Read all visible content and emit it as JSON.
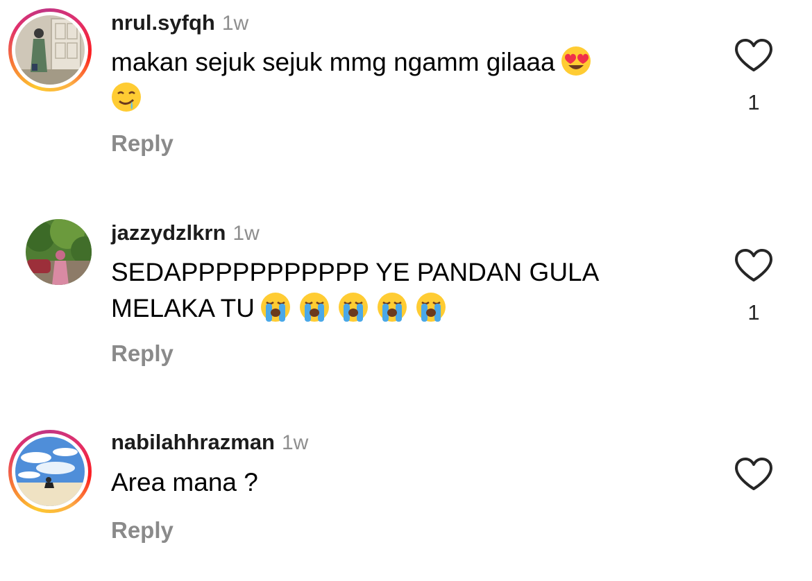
{
  "comments": [
    {
      "username": "nrul.syfqh",
      "time": "1w",
      "text": "makan sejuk sejuk mmg ngamm gilaaa",
      "emojis": [
        "heart-eyes-emoji",
        "drooling-emoji"
      ],
      "reply_label": "Reply",
      "likes": "1",
      "story_ring": true
    },
    {
      "username": "jazzydzlkrn",
      "time": "1w",
      "text_line1": "SEDAPPPPPPPPPPP YE PANDAN GULA",
      "text_line2": "MELAKA TU",
      "emojis": [
        "loudly-crying-emoji",
        "loudly-crying-emoji",
        "loudly-crying-emoji",
        "loudly-crying-emoji",
        "loudly-crying-emoji"
      ],
      "reply_label": "Reply",
      "likes": "1",
      "story_ring": false
    },
    {
      "username": "nabilahhrazman",
      "time": "1w",
      "text": "Area mana ?",
      "reply_label": "Reply",
      "story_ring": true
    }
  ],
  "colors": {
    "username": "#1c1c1c",
    "timestamp": "#8e8e8e",
    "reply": "#8a8a8a",
    "story_ring": [
      "#fdc830",
      "#f77737",
      "#e1306c",
      "#c13584"
    ]
  }
}
